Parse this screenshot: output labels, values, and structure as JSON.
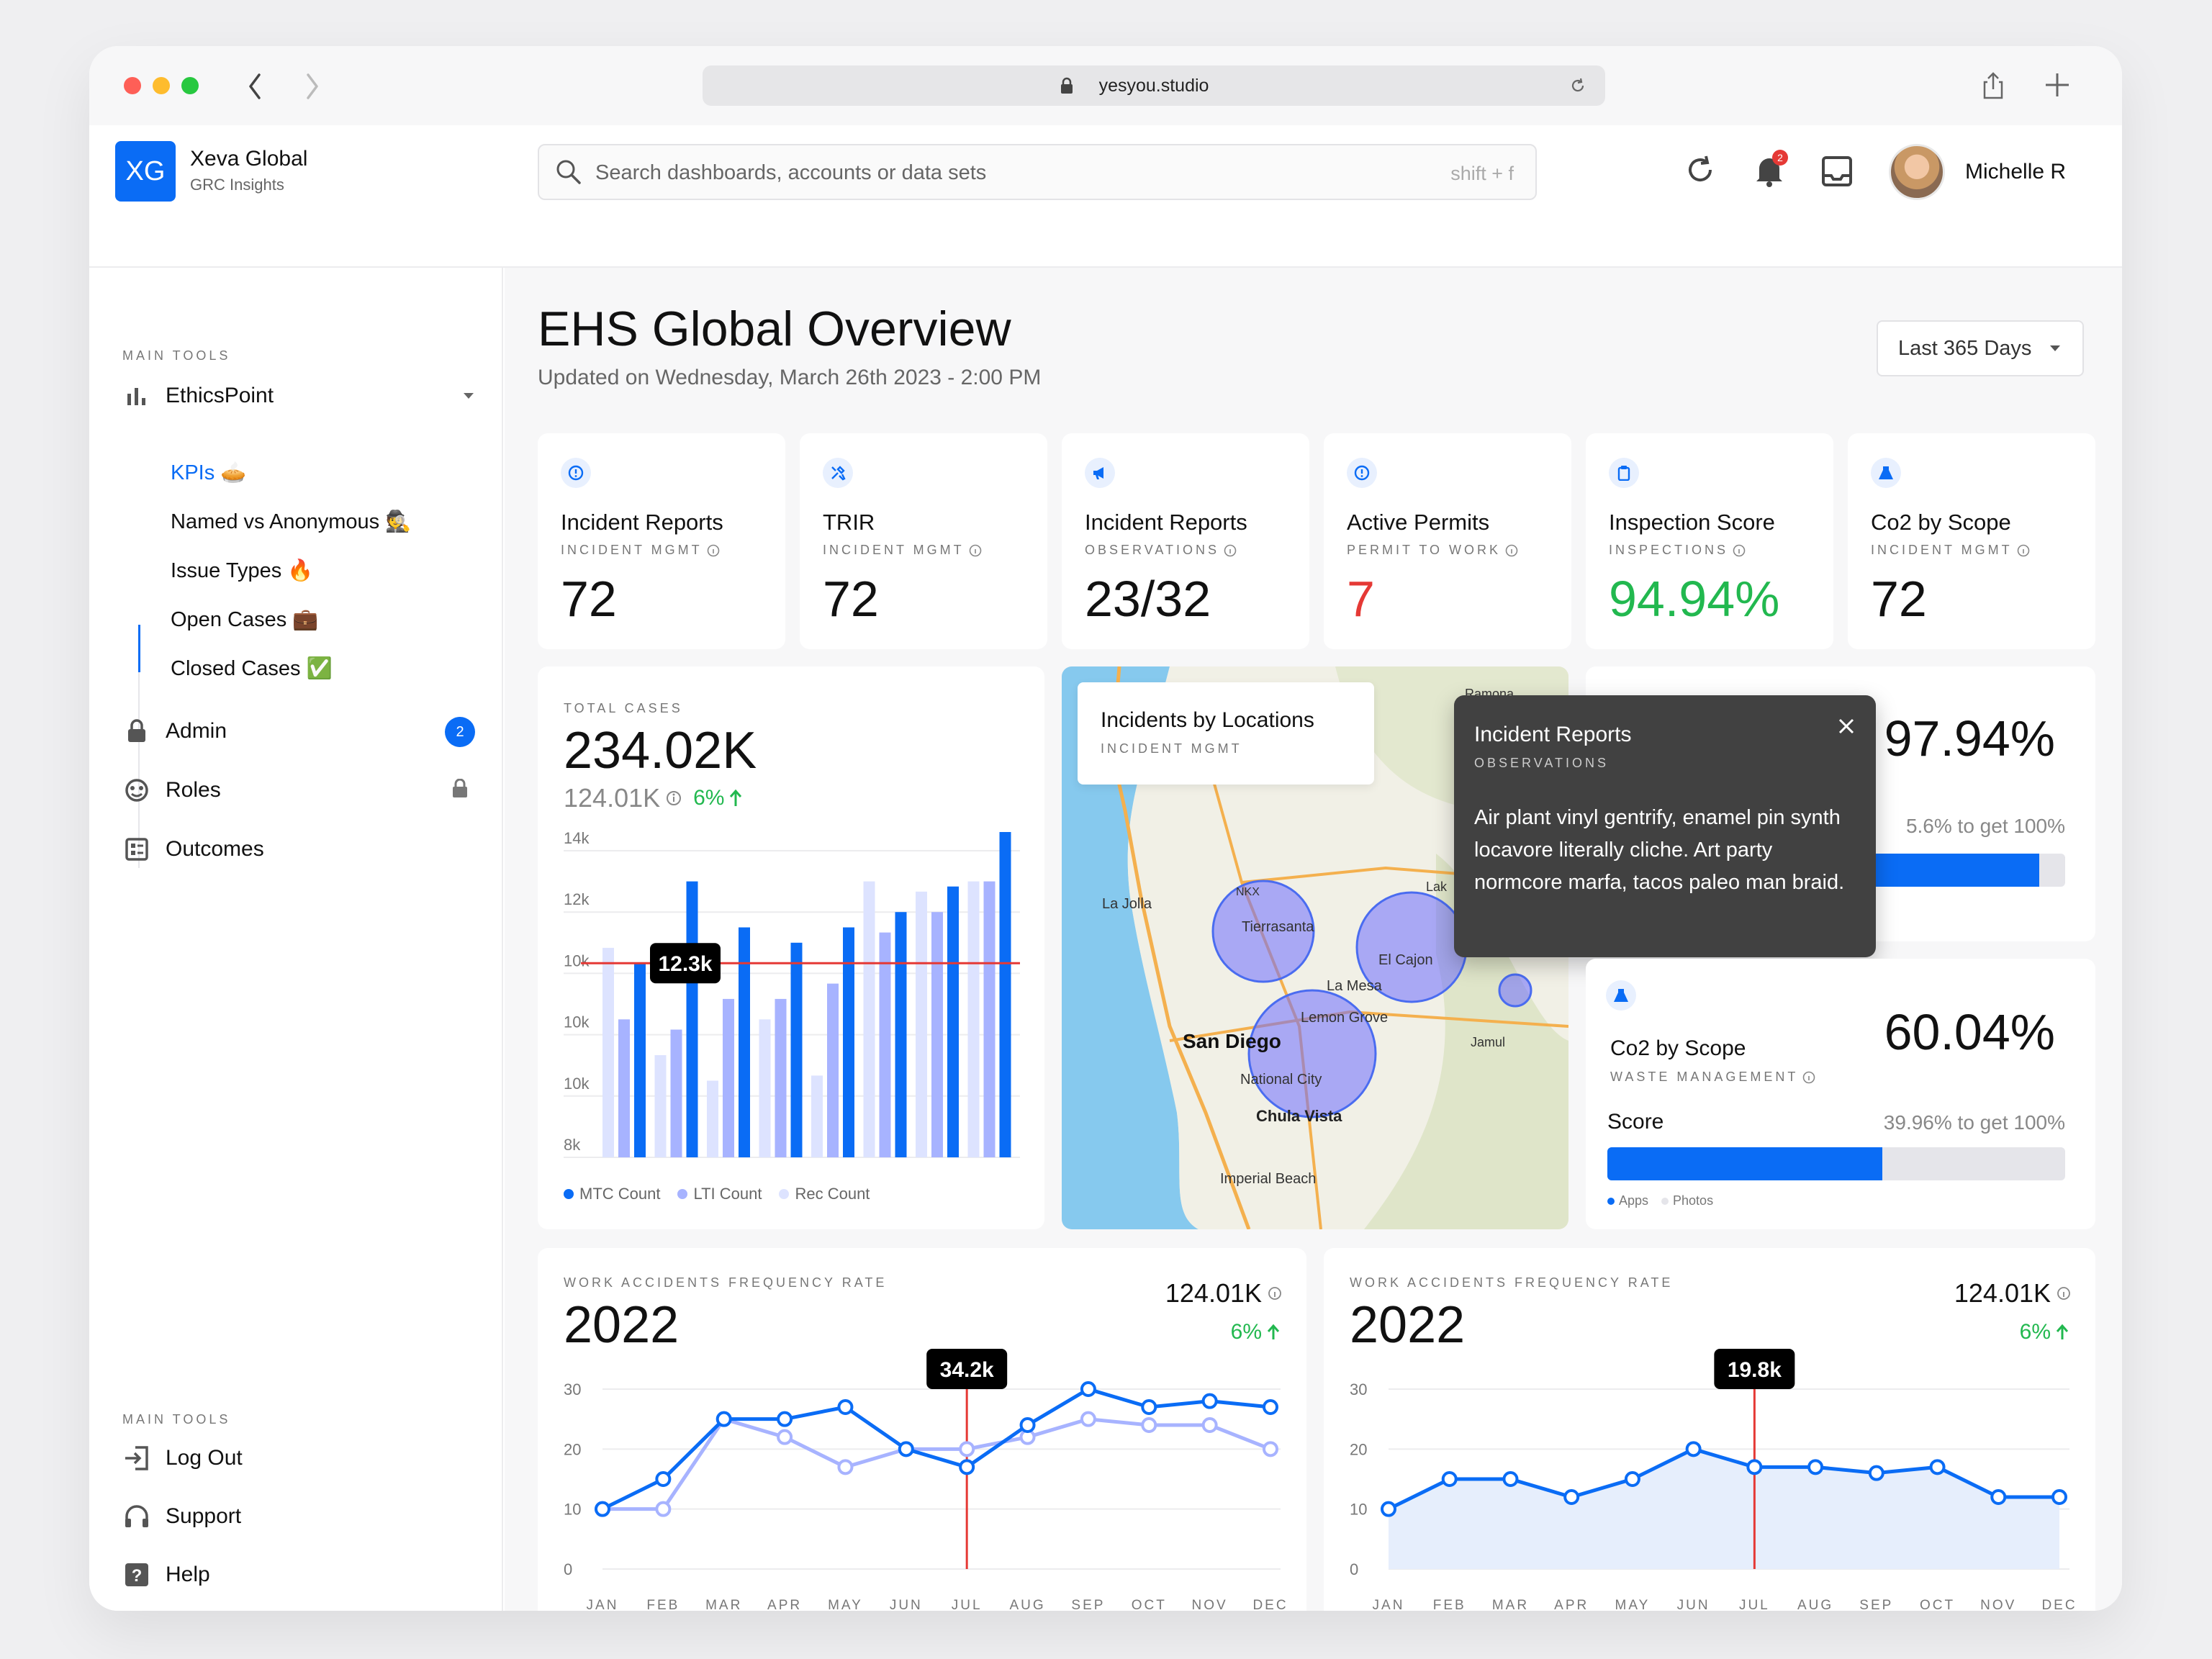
{
  "browser": {
    "url": "yesyou.studio"
  },
  "brand": {
    "logo": "XG",
    "name": "Xeva Global",
    "sub": "GRC Insights"
  },
  "search": {
    "placeholder": "Search dashboards, accounts or data sets",
    "shortcut": "shift + f"
  },
  "user": {
    "name": "Michelle R",
    "notifications": "2"
  },
  "sidebar": {
    "section1": "MAIN TOOLS",
    "group": "EthicsPoint",
    "subitems": [
      "KPIs 🥧",
      "Named vs Anonymous 🕵️",
      "Issue Types 🔥",
      "Open Cases 💼",
      "Closed Cases ✅"
    ],
    "admin": "Admin",
    "admin_badge": "2",
    "roles": "Roles",
    "outcomes": "Outcomes",
    "section2": "MAIN TOOLS",
    "logout": "Log Out",
    "support": "Support",
    "help": "Help"
  },
  "page": {
    "title": "EHS Global Overview",
    "updated": "Updated on Wednesday, March 26th 2023 - 2:00 PM",
    "range": "Last 365 Days"
  },
  "kpis": [
    {
      "title": "Incident Reports",
      "sub": "INCIDENT MGMT",
      "value": "72",
      "icon": "alert-icon"
    },
    {
      "title": "TRIR",
      "sub": "INCIDENT MGMT",
      "value": "72",
      "icon": "tools-icon"
    },
    {
      "title": "Incident Reports",
      "sub": "OBSERVATIONS",
      "value": "23/32",
      "icon": "megaphone-icon"
    },
    {
      "title": "Active Permits",
      "sub": "PERMIT TO WORK",
      "value": "7",
      "icon": "alert-icon"
    },
    {
      "title": "Inspection Score",
      "sub": "INSPECTIONS",
      "value": "94.94%",
      "icon": "clipboard-icon"
    },
    {
      "title": "Co2 by Scope",
      "sub": "INCIDENT MGMT",
      "value": "72",
      "icon": "flask-icon"
    }
  ],
  "colors": {
    "accent": "#0a6cf5",
    "red": "#e53935",
    "green": "#22b84f",
    "light1": "#a7b3ff",
    "light2": "#dde3ff"
  },
  "total_cases": {
    "label": "TOTAL CASES",
    "value": "234.02K",
    "sub": "124.01K",
    "change": "6%",
    "tooltip": "12.3k",
    "legend": [
      "MTC Count",
      "LTI Count",
      "Rec Count"
    ]
  },
  "map": {
    "title": "Incidents by Locations",
    "sub": "INCIDENT MGMT",
    "labels": [
      "La Jolla",
      "NKX",
      "Tierrasanta",
      "El Cajon",
      "La Mesa",
      "Lemon Grove",
      "San Diego",
      "National City",
      "Chula Vista",
      "Imperial Beach",
      "Jamul",
      "Lak",
      "Ramona"
    ]
  },
  "popover": {
    "title": "Incident Reports",
    "sub": "OBSERVATIONS",
    "body": "Air plant vinyl gentrify, enamel pin synth locavore literally cliche. Art party normcore marfa, tacos paleo man braid."
  },
  "progress1": {
    "value": "97.94%",
    "hint": "5.6% to get 100%",
    "fill": 0.944
  },
  "progress2": {
    "title": "Co2 by Scope",
    "sub": "WASTE MANAGEMENT",
    "value": "60.04%",
    "label": "Score",
    "hint": "39.96% to get 100%",
    "fill": 0.6004,
    "legend": [
      "Apps",
      "Photos"
    ]
  },
  "line1": {
    "label": "WORK ACCIDENTS FREQUENCY RATE",
    "year": "2022",
    "stat": "124.01K",
    "change": "6%",
    "tooltip": "34.2k"
  },
  "line2": {
    "label": "WORK ACCIDENTS FREQUENCY RATE",
    "year": "2022",
    "stat": "124.01K",
    "change": "6%",
    "tooltip": "19.8k"
  },
  "chart_data": [
    {
      "type": "bar",
      "yticks": [
        "14k",
        "12k",
        "10k",
        "10k",
        "10k",
        "8k"
      ],
      "ylim": [
        8,
        14
      ],
      "series": [
        {
          "name": "MTC Count",
          "values": [
            11.8,
            13.4,
            12.5,
            12.2,
            12.5,
            12.8,
            13.3,
            14.4
          ]
        },
        {
          "name": "LTI Count",
          "values": [
            10.7,
            10.5,
            11.1,
            11.1,
            11.4,
            12.4,
            12.8,
            13.4
          ]
        },
        {
          "name": "Rec Count",
          "values": [
            12.1,
            10.0,
            9.5,
            10.7,
            9.6,
            13.4,
            13.2,
            13.4
          ]
        }
      ],
      "reference_line": 11.8
    },
    {
      "type": "line",
      "categories": [
        "JAN",
        "FEB",
        "MAR",
        "APR",
        "MAY",
        "JUN",
        "JUL",
        "AUG",
        "SEP",
        "OCT",
        "NOV",
        "DEC"
      ],
      "yticks": [
        "30",
        "20",
        "10",
        "0"
      ],
      "ylim": [
        0,
        30
      ],
      "series": [
        {
          "values": [
            10,
            15,
            25,
            25,
            27,
            20,
            17,
            24,
            30,
            27,
            28,
            27
          ]
        },
        {
          "values": [
            10,
            10,
            25,
            22,
            17,
            20,
            20,
            22,
            25,
            24,
            24,
            20
          ]
        }
      ],
      "highlight_index": 6
    },
    {
      "type": "area",
      "categories": [
        "JAN",
        "FEB",
        "MAR",
        "APR",
        "MAY",
        "JUN",
        "JUL",
        "AUG",
        "SEP",
        "OCT",
        "NOV",
        "DEC"
      ],
      "yticks": [
        "30",
        "20",
        "10",
        "0"
      ],
      "ylim": [
        0,
        30
      ],
      "series": [
        {
          "values": [
            10,
            15,
            15,
            12,
            15,
            20,
            17,
            17,
            16,
            17,
            12,
            12
          ]
        }
      ],
      "highlight_index": 6
    }
  ]
}
